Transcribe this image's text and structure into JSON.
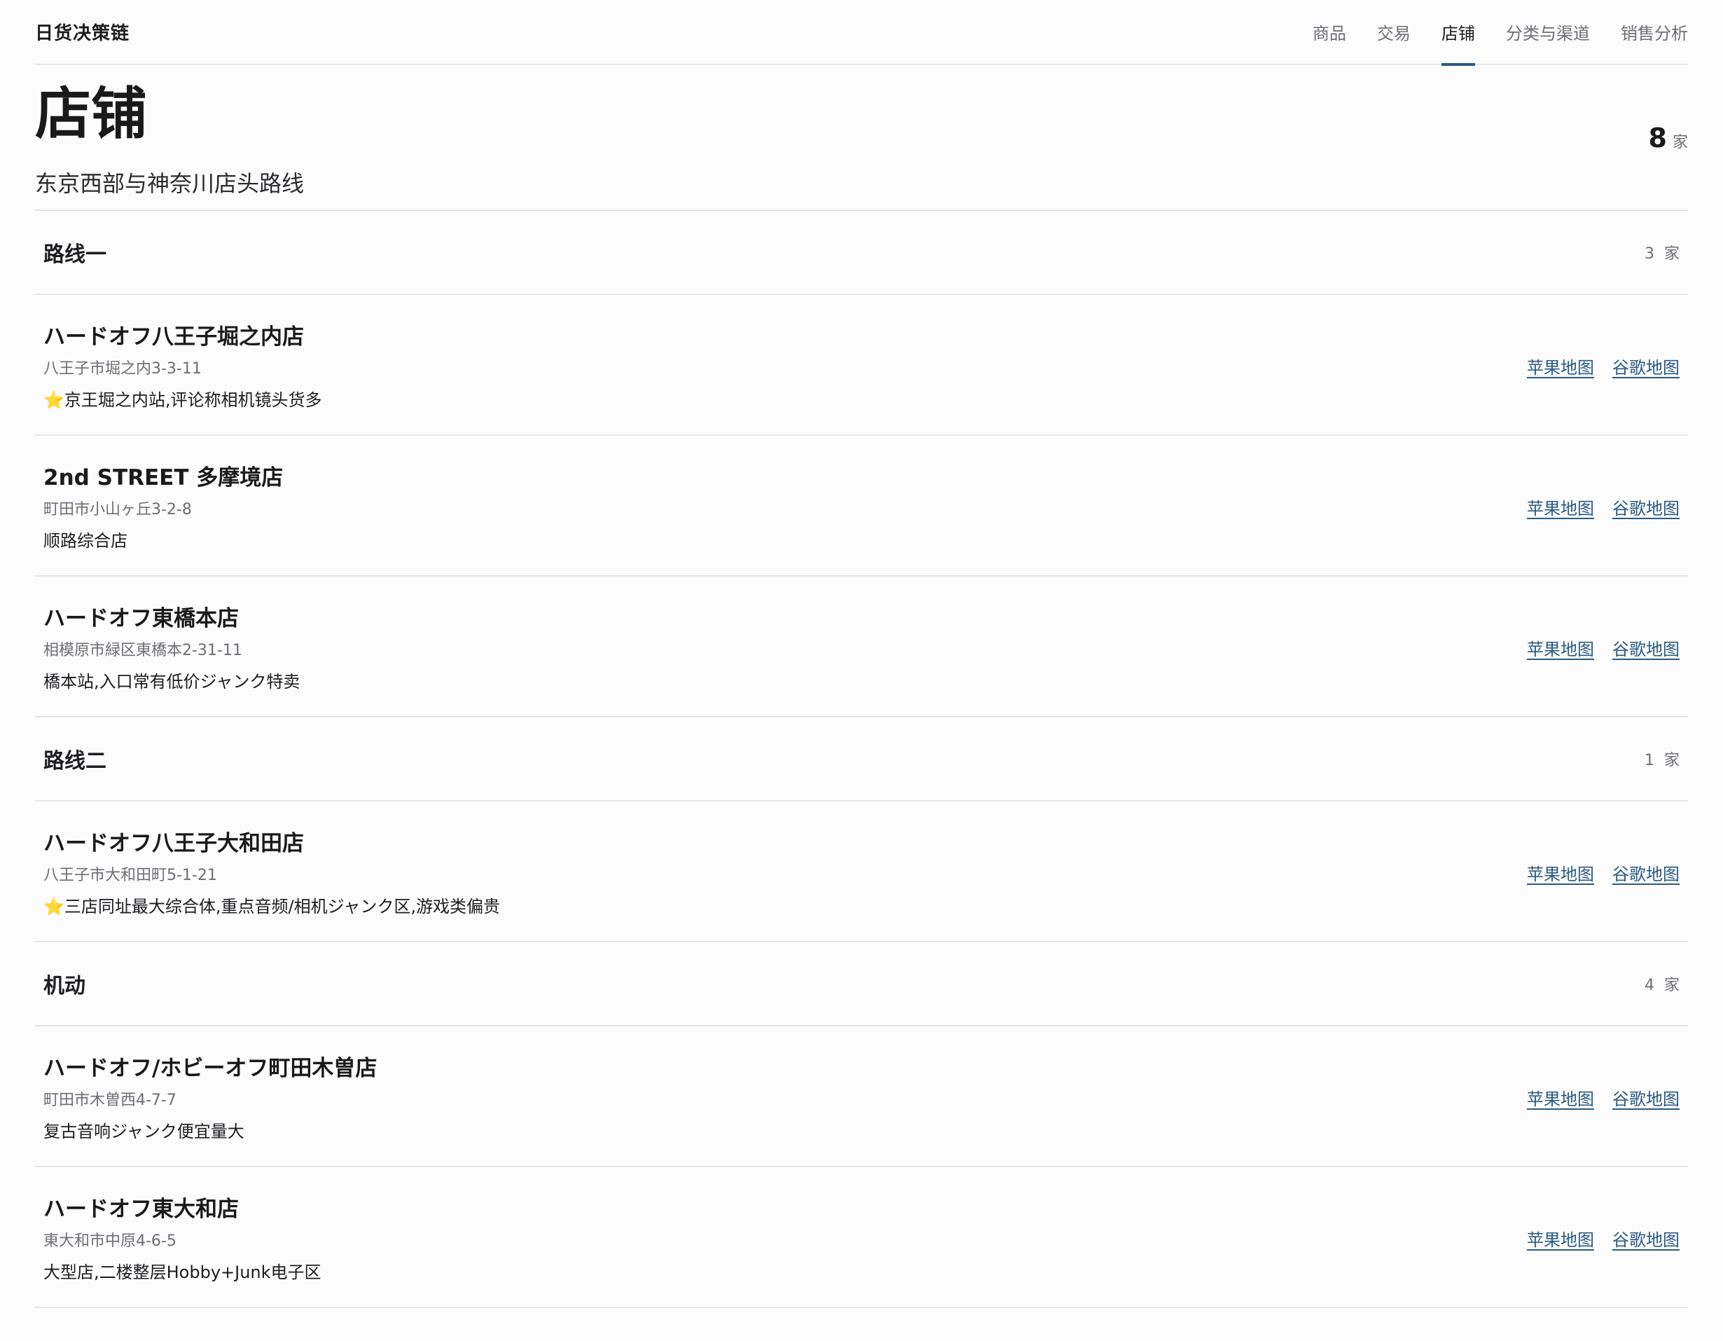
{
  "brand": "日货决策链",
  "nav": [
    {
      "label": "商品",
      "active": false
    },
    {
      "label": "交易",
      "active": false
    },
    {
      "label": "店铺",
      "active": true
    },
    {
      "label": "分类与渠道",
      "active": false
    },
    {
      "label": "销售分析",
      "active": false
    }
  ],
  "header": {
    "title": "店铺",
    "subtitle": "东京西部与神奈川店头路线",
    "count": "8",
    "count_unit": "家"
  },
  "link_labels": {
    "apple": "苹果地图",
    "google": "谷歌地图"
  },
  "groups": [
    {
      "title": "路线一",
      "count": "3",
      "unit": "家",
      "stores": [
        {
          "name": "ハードオフ八王子堀之内店",
          "address": "八王子市堀之内3-3-11",
          "note": "⭐京王堀之内站,评论称相机镜头货多"
        },
        {
          "name": "2nd STREET 多摩境店",
          "address": "町田市小山ヶ丘3-2-8",
          "note": "顺路综合店"
        },
        {
          "name": "ハードオフ東橋本店",
          "address": "相模原市緑区東橋本2-31-11",
          "note": "橋本站,入口常有低价ジャンク特卖"
        }
      ]
    },
    {
      "title": "路线二",
      "count": "1",
      "unit": "家",
      "stores": [
        {
          "name": "ハードオフ八王子大和田店",
          "address": "八王子市大和田町5-1-21",
          "note": "⭐三店同址最大综合体,重点音频/相机ジャンク区,游戏类偏贵"
        }
      ]
    },
    {
      "title": "机动",
      "count": "4",
      "unit": "家",
      "stores": [
        {
          "name": "ハードオフ/ホビーオフ町田木曽店",
          "address": "町田市木曽西4-7-7",
          "note": "复古音响ジャンク便宜量大"
        },
        {
          "name": "ハードオフ東大和店",
          "address": "東大和市中原4-6-5",
          "note": "大型店,二楼整层Hobby+Junk电子区"
        }
      ]
    }
  ]
}
